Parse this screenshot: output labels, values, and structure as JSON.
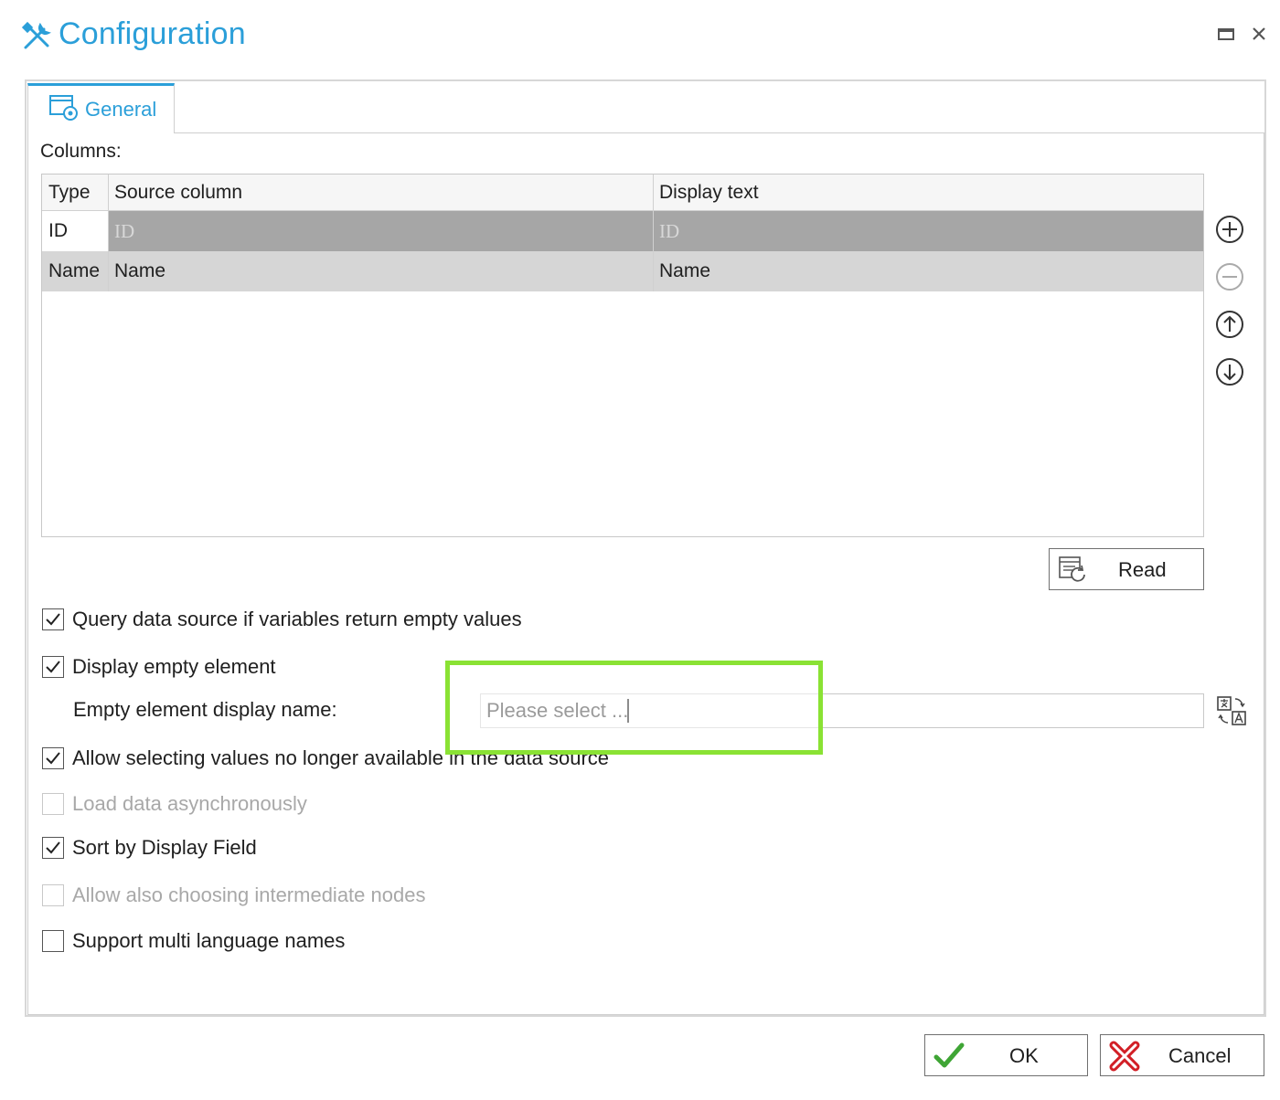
{
  "window": {
    "title": "Configuration",
    "icons": {
      "title": "tools-icon",
      "maximize": "maximize-icon",
      "close": "close-icon"
    }
  },
  "tabs": [
    {
      "label": "General",
      "icon": "settings-window-icon",
      "active": true
    }
  ],
  "columns": {
    "label": "Columns:",
    "headers": [
      "Type",
      "Source column",
      "Display text"
    ],
    "rows": [
      {
        "type": "ID",
        "source": "ID",
        "display": "ID",
        "selected": true
      },
      {
        "type": "Name",
        "source": "Name",
        "display": "Name",
        "selected": false
      }
    ],
    "side_buttons": [
      "add-icon",
      "remove-icon",
      "move-up-icon",
      "move-down-icon"
    ]
  },
  "read_button": {
    "label": "Read",
    "icon": "read-refresh-icon"
  },
  "options": [
    {
      "label": "Query data source if variables return empty values",
      "checked": true,
      "enabled": true
    },
    {
      "label": "Display empty element",
      "checked": true,
      "enabled": true
    },
    {
      "label": "Allow selecting values no longer available in the data source",
      "checked": true,
      "enabled": true
    },
    {
      "label": "Load data asynchronously",
      "checked": false,
      "enabled": false
    },
    {
      "label": "Sort by Display Field",
      "checked": true,
      "enabled": true
    },
    {
      "label": "Allow also choosing intermediate nodes",
      "checked": false,
      "enabled": false
    },
    {
      "label": "Support multi language names",
      "checked": false,
      "enabled": true
    }
  ],
  "empty_element": {
    "label": "Empty element display name:",
    "value": "Please select ...",
    "translate_icon": "translate-icon"
  },
  "buttons": {
    "ok": "OK",
    "cancel": "Cancel"
  },
  "colors": {
    "accent": "#2b9fd9",
    "highlight": "#8ae234",
    "selected_row": "#a6a6a6",
    "row": "#d6d6d6"
  }
}
